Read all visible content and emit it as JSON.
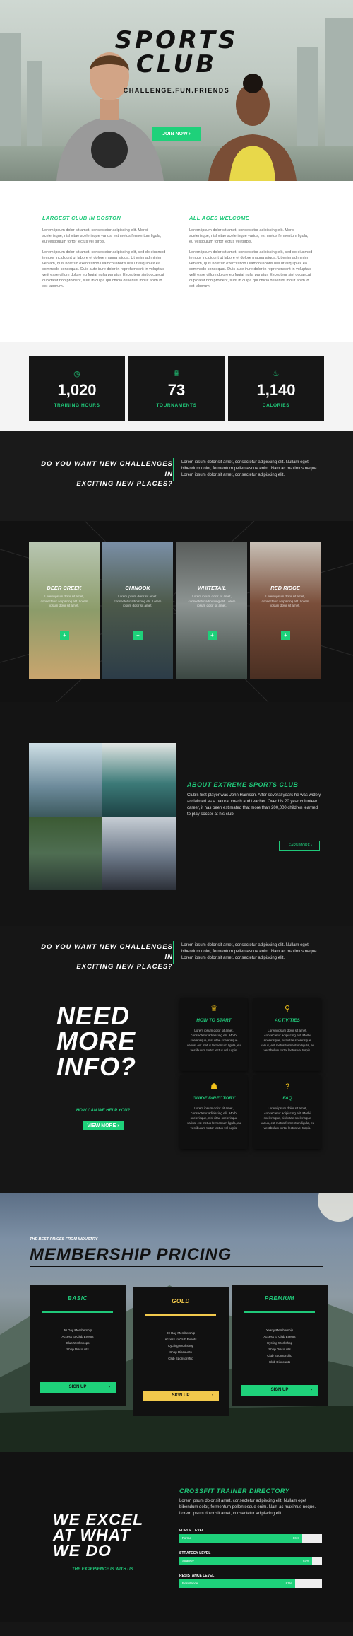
{
  "hero": {
    "title_line1": "SPORTS",
    "title_line2": "CLUB",
    "subtitle": "CHALLENGE.FUN.FRIENDS",
    "button": "JOIN NOW ›"
  },
  "intro": {
    "columns": [
      {
        "heading": "LARGEST CLUB IN BOSTON",
        "p1": "Lorem ipsum dolor sit amet, consectetur adipiscing elit. Morbi scelerisque, nisl vitae scelerisque varius, est metus fermentum ligula, eu vestibulum tortor lectus vel turpis.",
        "p2": "Lorem ipsum dolor sit amet, consectetur adipiscing elit, sed do eiusmod tempor incididunt ut labore et dolore magna aliqua. Ut enim ad minim veniam, quis nostrud exercitation ullamco laboris nisi ut aliquip ex ea commodo consequat. Duis aute irure dolor in reprehenderit in voluptate velit esse cillum dolore eu fugiat nulla pariatur. Excepteur sint occaecat cupidatat non proident, sunt in culpa qui officia deserunt mollit anim id est laborum."
      },
      {
        "heading": "ALL AGES WELCOME",
        "p1": "Lorem ipsum dolor sit amet, consectetur adipiscing elit. Morbi scelerisque, nisl vitae scelerisque varius, est metus fermentum ligula, eu vestibulum tortor lectus vel turpis.",
        "p2": "Lorem ipsum dolor sit amet, consectetur adipiscing elit, sed do eiusmod tempor incididunt ut labore et dolore magna aliqua. Ut enim ad minim veniam, quis nostrud exercitation ullamco laboris nisi ut aliquip ex ea commodo consequat. Duis aute irure dolor in reprehenderit in voluptate velit esse cillum dolore eu fugiat nulla pariatur. Excepteur sint occaecat cupidatat non proident, sunt in culpa qui officia deserunt mollit anim id est laborum."
      }
    ]
  },
  "stats": [
    {
      "icon": "clock-icon",
      "value": "1,020",
      "label": "TRAINING HOURS"
    },
    {
      "icon": "trophy-icon",
      "value": "73",
      "label": "TOURNAMENTS"
    },
    {
      "icon": "flame-icon",
      "value": "1,140",
      "label": "CALORIES"
    }
  ],
  "challenge": {
    "question_line1": "DO YOU WANT NEW CHALLENGES IN",
    "question_line2": "EXCITING NEW PLACES?",
    "text": "Lorem ipsum dolor sit amet, consectetur adipiscing elit. Nullam eget bibendum dolor, fermentum pellentesque enim. Nam ac maximus neque. Lorem ipsum dolor sit amet, consectetur adipiscing elit."
  },
  "cards": [
    {
      "title": "DEER CREEK",
      "text": "Lorem ipsum dolor sit amet, consectetur adipiscing elit. Lorem ipsum dolor sit amet."
    },
    {
      "title": "CHINOOK",
      "text": "Lorem ipsum dolor sit amet, consectetur adipiscing elit. Lorem ipsum dolor sit amet."
    },
    {
      "title": "WHITETAIL",
      "text": "Lorem ipsum dolor sit amet, consectetur adipiscing elit. Lorem ipsum dolor sit amet."
    },
    {
      "title": "RED RIDGE",
      "text": "Lorem ipsum dolor sit amet, consectetur adipiscing elit. Lorem ipsum dolor sit amet."
    }
  ],
  "card_button": "+",
  "about": {
    "heading": "ABOUT EXTREME SPORTS CLUB",
    "text": "Club's first player was John Harrison. After several years he was widely acclaimed as a natural coach and teacher. Over his 20 year volunteer career, it has been estimated that more than 200,000 children learned to play soccer at his club.",
    "button": "LEARN MORE ›"
  },
  "challenge2": {
    "question_line1": "DO YOU WANT NEW CHALLENGES IN",
    "question_line2": "EXCITING NEW PLACES?",
    "text": "Lorem ipsum dolor sit amet, consectetur adipiscing elit. Nullam eget bibendum dolor, fermentum pellentesque enim. Nam ac maximus neque. Lorem ipsum dolor sit amet, consectetur adipiscing elit."
  },
  "info": {
    "line1": "NEED",
    "line2": "MORE",
    "line3": "INFO?",
    "how": "HOW CAN WE HELP YOU?",
    "button": "VIEW MORE ›",
    "boxes": [
      {
        "icon": "trophy-icon",
        "title": "HOW TO START",
        "text": "Lorem ipsum dolor sit amet, consectetur adipiscing elit. Morbi scelerisque, nisl vitae scelerisque varius, est metus fermentum ligula, eu vestibulum tortor lectus vel turpis."
      },
      {
        "icon": "bike-icon",
        "title": "ACTIVITIES",
        "text": "Lorem ipsum dolor sit amet, consectetur adipiscing elit. Morbi scelerisque, nisl vitae scelerisque varius, est metus fermentum ligula, eu vestibulum tortor lectus vel turpis."
      },
      {
        "icon": "person-icon",
        "title": "GUIDE DIRECTORY",
        "text": "Lorem ipsum dolor sit amet, consectetur adipiscing elit. Morbi scelerisque, nisl vitae scelerisque varius, est metus fermentum ligula, eu vestibulum tortor lectus vel turpis."
      },
      {
        "icon": "question-icon",
        "title": "FAQ",
        "text": "Lorem ipsum dolor sit amet, consectetur adipiscing elit. Morbi scelerisque, nisl vitae scelerisque varius, est metus fermentum ligula, eu vestibulum tortor lectus vel turpis."
      }
    ]
  },
  "pricing": {
    "small": "THE BEST PRICES FROM INDUSTRY",
    "title": "MEMBERSHIP PRICING",
    "plans": [
      {
        "name": "BASIC",
        "accent": "#20c97a",
        "features": [
          "30 Day Membership",
          "Access to Club Events",
          "Club Workshops",
          "Shop Discounts"
        ],
        "button": "SIGN UP",
        "arrow": "›"
      },
      {
        "name": "GOLD",
        "accent": "#f2c94c",
        "features": [
          "90 Day Membership",
          "Access to Club Events",
          "Cycling Workshop",
          "Shop Discounts",
          "Club Sponsorship"
        ],
        "button": "SIGN UP",
        "arrow": "›"
      },
      {
        "name": "PREMIUM",
        "accent": "#20c97a",
        "features": [
          "Yearly Membership",
          "Access to Club Events",
          "Cycling Workshop",
          "Shop Discounts",
          "Club Sponsorship",
          "Club Discounts"
        ],
        "button": "SIGN UP",
        "arrow": "›"
      }
    ]
  },
  "excel": {
    "line1": "WE EXCEL",
    "line2": "AT WHAT",
    "line3": "WE DO",
    "sub": "THE EXPERIENCE IS WITH US",
    "heading": "CROSSFIT TRAINER DIRECTORY",
    "text": "Lorem ipsum dolor sit amet, consectetur adipiscing elit. Nullam eget bibendum dolor, fermentum pellentesque enim. Nam ac maximus neque. Lorem ipsum dolor sit amet, consectetur adipiscing elit.",
    "skills": [
      {
        "label": "FORCE LEVEL",
        "inner": "Forme",
        "percent": 86,
        "percent_text": "86%"
      },
      {
        "label": "STRATEGY LEVEL",
        "inner": "Strategy",
        "percent": 93,
        "percent_text": "93%"
      },
      {
        "label": "RESISTANCE LEVEL",
        "inner": "Resistance",
        "percent": 81,
        "percent_text": "81%"
      }
    ]
  },
  "colors": {
    "accent": "#20c97a",
    "gold": "#f2c94c",
    "dark": "#161616"
  }
}
